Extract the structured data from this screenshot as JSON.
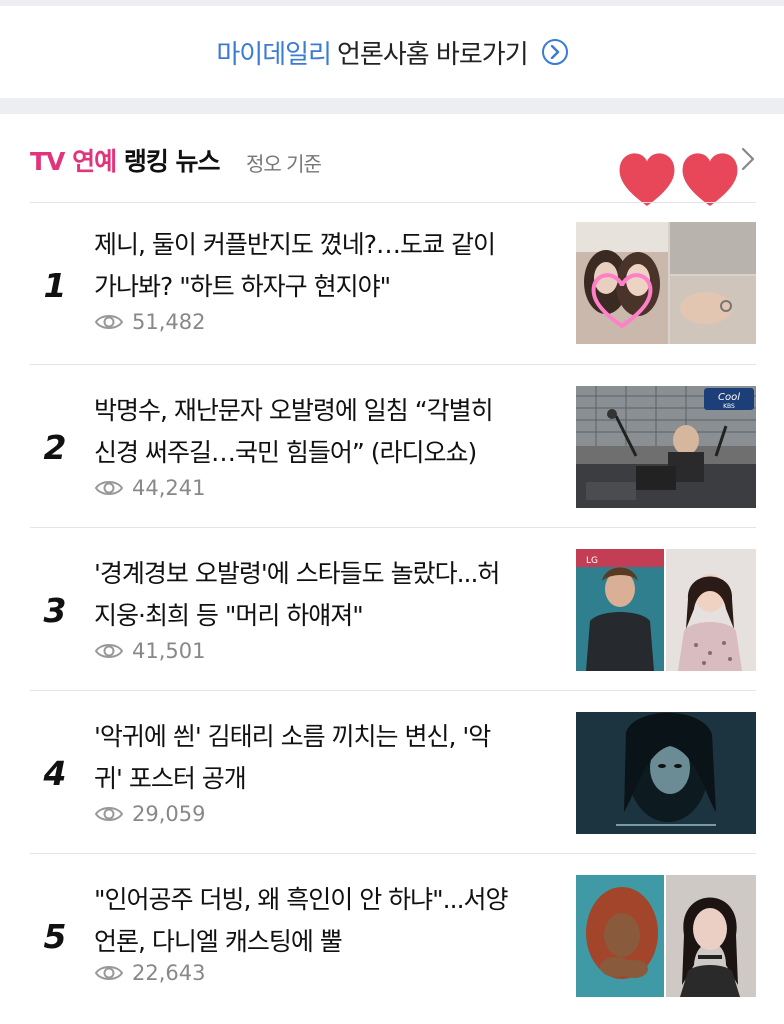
{
  "press_link": {
    "brand": "마이데일리",
    "label": "언론사홈 바로가기"
  },
  "section": {
    "title_pink": "TV 연예",
    "title_dark": "랭킹 뉴스",
    "subtitle": "정오 기준"
  },
  "news": [
    {
      "rank": "1",
      "headline_line1": "제니, 둘이 커플반지도 꼈네?…도쿄 같이",
      "headline_line2": "가나봐? \"하트 하자구 현지야\"",
      "views": "51,482"
    },
    {
      "rank": "2",
      "headline_line1": "박명수, 재난문자 오발령에 일침 “각별히",
      "headline_line2": "신경 써주길…국민 힘들어” (라디오쇼)",
      "views": "44,241"
    },
    {
      "rank": "3",
      "headline_line1": "'경계경보 오발령'에 스타들도 놀랐다...허",
      "headline_line2": "지웅·최희 등 \"머리 하얘져\"",
      "views": "41,501"
    },
    {
      "rank": "4",
      "headline_line1": "'악귀에 씐' 김태리 소름 끼치는 변신, '악",
      "headline_line2": "귀' 포스터 공개",
      "views": "29,059"
    },
    {
      "rank": "5",
      "headline_line1": "\"인어공주 더빙, 왜 흑인이 안 하냐\"...서양",
      "headline_line2": "언론, 다니엘 캐스팅에 뿔",
      "views": "22,643"
    }
  ],
  "thumb2_logo": "Cool",
  "thumb2_logo_sub": "KBS",
  "thumb3_wall": "LG",
  "colors": {
    "brand_blue": "#3a7bd5",
    "accent_pink": "#e2337b",
    "heart_red": "#e8475a",
    "divider": "#e4e4e4",
    "meta_gray": "#888888"
  },
  "icons": [
    "chevron-right-circle-icon",
    "chevron-right-icon",
    "heart-icon",
    "eye-icon"
  ]
}
